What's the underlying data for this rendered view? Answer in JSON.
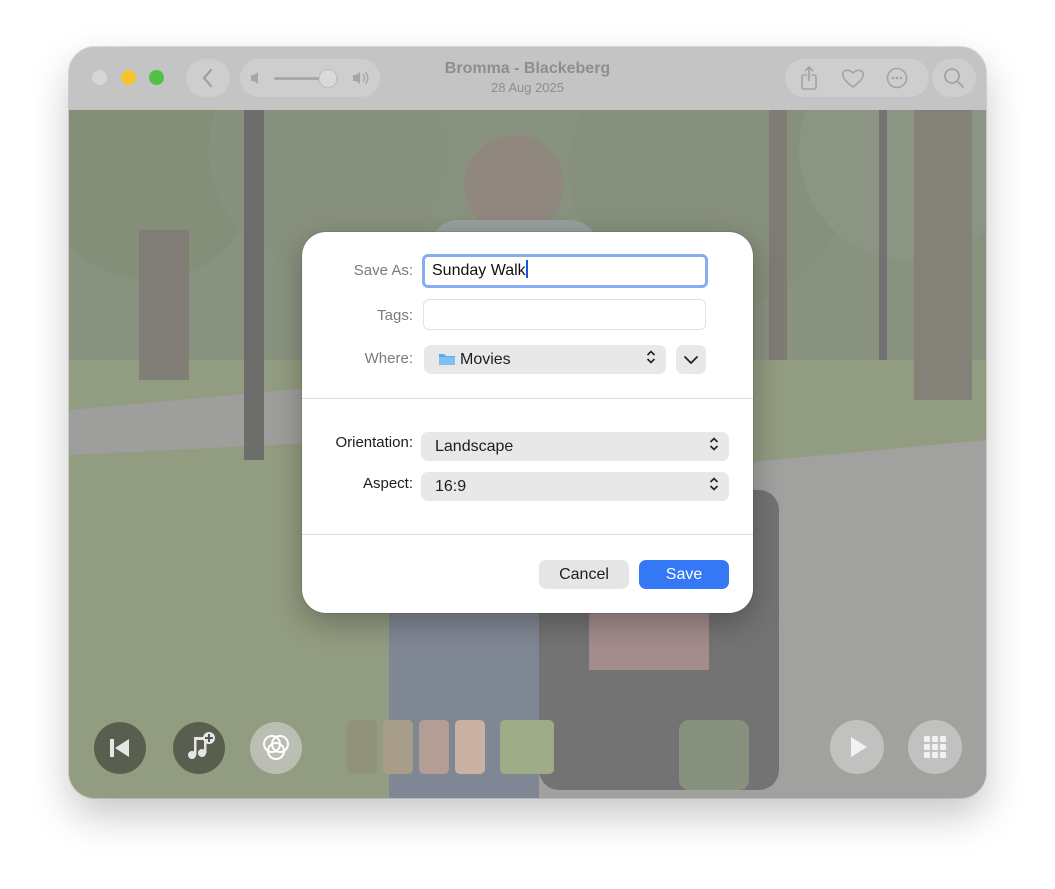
{
  "window": {
    "title": "Bromma - Blackeberg",
    "subtitle": "28 Aug 2025"
  },
  "toolbar": {
    "icons": [
      "back-chevron-icon",
      "volume-low-icon",
      "volume-slider",
      "volume-high-icon",
      "share-icon",
      "heart-icon",
      "more-icon",
      "search-icon"
    ],
    "volume_level": 0.8
  },
  "dialog": {
    "save_as_label": "Save As:",
    "save_as_value": "Sunday Walk",
    "tags_label": "Tags:",
    "tags_value": "",
    "where_label": "Where:",
    "where_value": "Movies",
    "orientation_label": "Orientation:",
    "orientation_value": "Landscape",
    "aspect_label": "Aspect:",
    "aspect_value": "16:9",
    "cancel_label": "Cancel",
    "save_label": "Save",
    "accent_color": "#3478f6"
  },
  "bottom_controls": {
    "icons": [
      "skip-back-icon",
      "add-music-icon",
      "filters-icon",
      "play-icon",
      "grid-icon"
    ],
    "thumbnail_count": 5
  }
}
